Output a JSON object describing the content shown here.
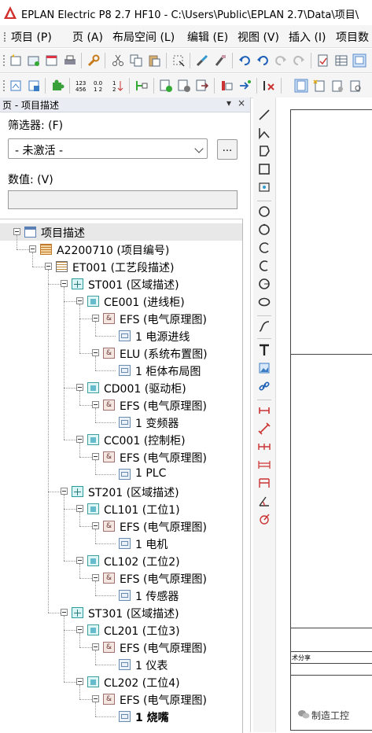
{
  "window": {
    "title": "EPLAN Electric P8 2.7 HF10 - C:\\Users\\Public\\EPLAN 2.7\\Data\\项目\\"
  },
  "menu": {
    "items": [
      "项目 (P)",
      "页 (A)",
      "布局空间 (L)",
      "编辑 (E)",
      "视图 (V)",
      "插入 (I)",
      "项目数"
    ]
  },
  "panel": {
    "title": "页 - 项目描述",
    "pin": "▾",
    "close": "×",
    "filter_label": "筛选器: (F)",
    "filter_value": "- 未激活 -",
    "more_button": "...",
    "value_label": "数值: (V)",
    "value_input": ""
  },
  "tree": {
    "nodes": [
      {
        "label": "项目描述",
        "level": 0,
        "icon": "project-root-icon",
        "expander": true,
        "selected": true
      },
      {
        "label": "A2200710 (项目编号)",
        "level": 1,
        "icon": "project-number-icon",
        "expander": true
      },
      {
        "label": "ET001 (工艺段描述)",
        "level": 2,
        "icon": "process-section-icon",
        "expander": true
      },
      {
        "label": "ST001 (区域描述)",
        "level": 3,
        "icon": "area-icon",
        "expander": true
      },
      {
        "label": "CE001 (进线柜)",
        "level": 4,
        "icon": "cabinet-icon",
        "expander": true
      },
      {
        "label": "EFS (电气原理图)",
        "level": 5,
        "icon": "document-type-icon",
        "expander": true
      },
      {
        "label": "1 电源进线",
        "level": 6,
        "icon": "page-icon",
        "expander": false
      },
      {
        "label": "ELU (系统布置图)",
        "level": 5,
        "icon": "document-type-icon",
        "expander": true
      },
      {
        "label": "1 柜体布局图",
        "level": 6,
        "icon": "page-icon",
        "expander": false
      },
      {
        "label": "CD001 (驱动柜)",
        "level": 4,
        "icon": "cabinet-icon",
        "expander": true
      },
      {
        "label": "EFS (电气原理图)",
        "level": 5,
        "icon": "document-type-icon",
        "expander": true
      },
      {
        "label": "1 变频器",
        "level": 6,
        "icon": "page-icon",
        "expander": false
      },
      {
        "label": "CC001 (控制柜)",
        "level": 4,
        "icon": "cabinet-icon",
        "expander": true
      },
      {
        "label": "EFS (电气原理图)",
        "level": 5,
        "icon": "document-type-icon",
        "expander": true
      },
      {
        "label": "1 PLC",
        "level": 6,
        "icon": "page-icon",
        "expander": false
      },
      {
        "label": "ST201 (区域描述)",
        "level": 3,
        "icon": "area-icon",
        "expander": true
      },
      {
        "label": "CL101 (工位1)",
        "level": 4,
        "icon": "cabinet-icon",
        "expander": true
      },
      {
        "label": "EFS (电气原理图)",
        "level": 5,
        "icon": "document-type-icon",
        "expander": true
      },
      {
        "label": "1 电机",
        "level": 6,
        "icon": "page-icon",
        "expander": false
      },
      {
        "label": "CL102 (工位2)",
        "level": 4,
        "icon": "cabinet-icon",
        "expander": true
      },
      {
        "label": "EFS (电气原理图)",
        "level": 5,
        "icon": "document-type-icon",
        "expander": true
      },
      {
        "label": "1 传感器",
        "level": 6,
        "icon": "page-icon",
        "expander": false
      },
      {
        "label": "ST301 (区域描述)",
        "level": 3,
        "icon": "area-icon",
        "expander": true
      },
      {
        "label": "CL201 (工位3)",
        "level": 4,
        "icon": "cabinet-icon",
        "expander": true
      },
      {
        "label": "EFS (电气原理图)",
        "level": 5,
        "icon": "document-type-icon",
        "expander": true
      },
      {
        "label": "1 仪表",
        "level": 6,
        "icon": "page-icon",
        "expander": false
      },
      {
        "label": "CL202 (工位4)",
        "level": 4,
        "icon": "cabinet-icon",
        "expander": true
      },
      {
        "label": "EFS (电气原理图)",
        "level": 5,
        "icon": "document-type-icon",
        "expander": true
      },
      {
        "label": "1 烧嘴",
        "level": 6,
        "icon": "page-icon",
        "expander": false,
        "bold": true
      }
    ]
  },
  "canvas": {
    "sheet_text": "术分享"
  },
  "watermark": {
    "text": "制造工控"
  },
  "colors": {
    "accent": "#0b6fc0",
    "eplan_red": "#d0312d"
  }
}
